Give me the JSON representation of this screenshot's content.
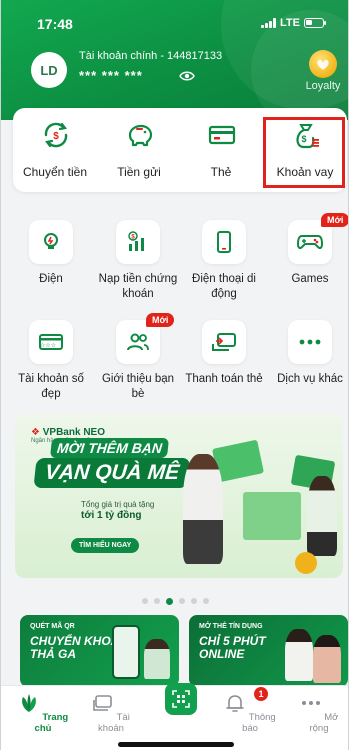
{
  "status_bar": {
    "time": "17:48",
    "network": "LTE"
  },
  "account": {
    "avatar_initials": "LD",
    "name": "Tài khoản chính - 144817133",
    "balance_masked": "*** *** ***",
    "loyalty_label": "Loyalty"
  },
  "quick_actions": [
    {
      "label": "Chuyển tiền",
      "icon": "transfer-money-icon"
    },
    {
      "label": "Tiền gửi",
      "icon": "piggy-bank-icon"
    },
    {
      "label": "Thẻ",
      "icon": "card-icon"
    },
    {
      "label": "Khoản vay",
      "icon": "loan-bag-icon",
      "highlighted": true
    }
  ],
  "services": [
    {
      "label": "Điện",
      "icon": "electricity-bulb-icon"
    },
    {
      "label": "Nạp tiền chứng khoán",
      "icon": "stock-topup-icon"
    },
    {
      "label": "Điện thoại di động",
      "icon": "mobile-phone-icon"
    },
    {
      "label": "Games",
      "icon": "gamepad-icon",
      "badge": "Mới"
    },
    {
      "label": "Tài khoản số đẹp",
      "icon": "nice-number-account-icon"
    },
    {
      "label": "Giới thiệu bạn bè",
      "icon": "refer-friends-icon",
      "badge": "Mới"
    },
    {
      "label": "Thanh toán thẻ",
      "icon": "card-payment-icon"
    },
    {
      "label": "Dịch vụ khác",
      "icon": "more-dots-icon"
    }
  ],
  "banner": {
    "brand": "VPBank NEO",
    "tagline": "Ngân hàng số toàn năng",
    "headline_1": "MỜI THÊM BẠN",
    "headline_2": "VẠN QUÀ MÊ",
    "sub_1": "Tổng giá trị quà tặng",
    "sub_2": "tới 1 tỷ đồng",
    "cta": "TÌM HIỂU NGAY"
  },
  "carousel": {
    "count": 6,
    "active_index": 2
  },
  "mini_banners": [
    {
      "top": "QUÉT MÃ QR",
      "line1": "CHUYỂN KHOẢN",
      "line2": "THẢ GA"
    },
    {
      "top": "MỞ THẺ TÍN DỤNG",
      "line1": "CHỈ 5 PHÚT",
      "line2": "ONLINE"
    }
  ],
  "tabbar": [
    {
      "label": "Trang chủ",
      "icon": "home-leaf-icon",
      "active": true
    },
    {
      "label": "Tài khoản",
      "icon": "account-icon"
    },
    {
      "label": "",
      "icon": "qr-scan-icon"
    },
    {
      "label": "Thông báo",
      "icon": "bell-icon",
      "badge": "1"
    },
    {
      "label": "Mở rộng",
      "icon": "more-horizontal-icon"
    }
  ],
  "colors": {
    "brand_green": "#0f8a45",
    "alert_red": "#e2231a",
    "highlight_border": "#e0231c"
  }
}
